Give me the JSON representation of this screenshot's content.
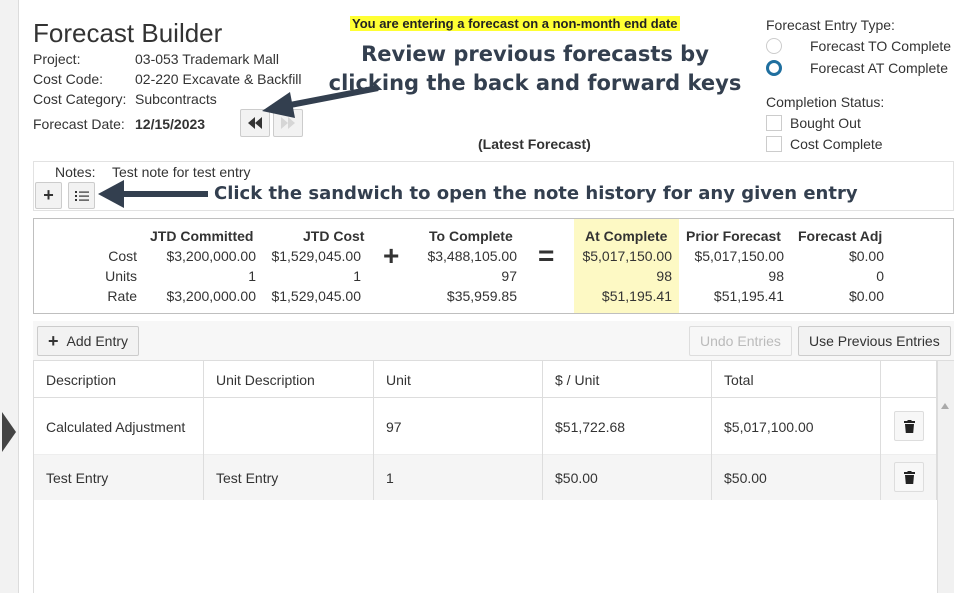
{
  "header": {
    "title": "Forecast Builder",
    "project_label": "Project:",
    "project_value": "03-053 Trademark Mall",
    "cost_code_label": "Cost Code:",
    "cost_code_value": "02-220 Excavate & Backfill",
    "cost_category_label": "Cost Category:",
    "cost_category_value": "Subcontracts",
    "forecast_date_label": "Forecast Date:",
    "forecast_date_value": "12/15/2023"
  },
  "banner": "You are entering a forecast on a non-month end date",
  "latest_label": "(Latest Forecast)",
  "annotations": {
    "review": "Review previous forecasts by clicking the back and forward keys",
    "sandwich": "Click the sandwich to open the note history for any given entry"
  },
  "entry_type": {
    "label": "Forecast Entry Type:",
    "options": [
      {
        "label": "Forecast TO Complete",
        "checked": false
      },
      {
        "label": "Forecast AT Complete",
        "checked": true
      }
    ]
  },
  "completion_status": {
    "label": "Completion Status:",
    "options": [
      {
        "label": "Bought Out",
        "checked": false
      },
      {
        "label": "Cost Complete",
        "checked": false
      }
    ]
  },
  "notes": {
    "label": "Notes:",
    "text": "Test note for test entry",
    "add_glyph": "+"
  },
  "summary": {
    "row_labels": [
      "Cost",
      "Units",
      "Rate"
    ],
    "columns": [
      {
        "header": "JTD Committed",
        "values": [
          "$3,200,000.00",
          "1",
          "$3,200,000.00"
        ]
      },
      {
        "header": "JTD Cost",
        "values": [
          "$1,529,045.00",
          "1",
          "$1,529,045.00"
        ]
      },
      {
        "header": "To Complete",
        "values": [
          "$3,488,105.00",
          "97",
          "$35,959.85"
        ]
      },
      {
        "header": "At Complete",
        "values": [
          "$5,017,150.00",
          "98",
          "$51,195.41"
        ]
      },
      {
        "header": "Prior Forecast",
        "values": [
          "$5,017,150.00",
          "98",
          "$51,195.41"
        ]
      },
      {
        "header": "Forecast Adj",
        "values": [
          "$0.00",
          "0",
          "$0.00"
        ]
      }
    ],
    "plus_op": "+",
    "equals_op": "="
  },
  "toolbar": {
    "add_entry": "Add Entry",
    "add_glyph": "+",
    "undo_entries": "Undo Entries",
    "use_previous": "Use Previous Entries"
  },
  "table": {
    "headers": [
      "Description",
      "Unit Description",
      "Unit",
      "$ / Unit",
      "Total"
    ],
    "rows": [
      {
        "description": "Calculated Adjustment",
        "unit_description": "",
        "unit": "97",
        "per_unit": "$51,722.68",
        "total": "$5,017,100.00"
      },
      {
        "description": "Test Entry",
        "unit_description": "Test Entry",
        "unit": "1",
        "per_unit": "$50.00",
        "total": "$50.00"
      }
    ]
  },
  "icons": {
    "back": "rewind-icon",
    "forward": "fast-forward-icon",
    "history": "list-icon",
    "delete": "trash-icon"
  },
  "colors": {
    "highlight": "#fdf9c4",
    "banner": "#ffff33",
    "radio_checked": "#1f6f9f",
    "annotation": "#333f4f"
  }
}
